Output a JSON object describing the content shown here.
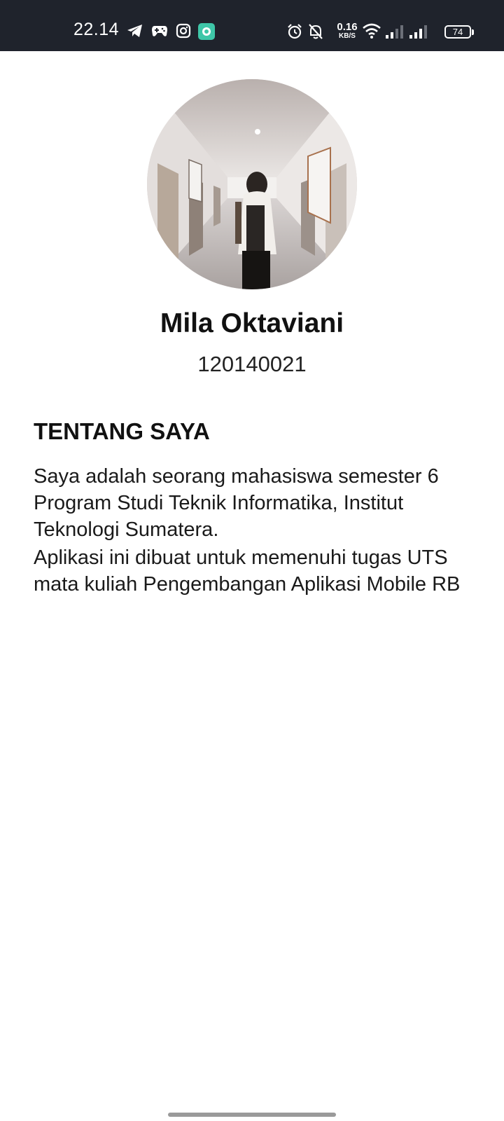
{
  "status_bar": {
    "time": "22.14",
    "speed_value": "0.16",
    "speed_unit": "KB/S",
    "battery": "74",
    "icons": [
      "telegram-icon",
      "gamepad-icon",
      "instagram-icon",
      "chat-app-icon",
      "alarm-icon",
      "bell-off-icon",
      "wifi-icon",
      "signal-icon",
      "signal-icon",
      "battery-icon"
    ]
  },
  "profile": {
    "name": "Mila Oktaviani",
    "nim": "120140021"
  },
  "about": {
    "title": "TENTANG SAYA",
    "paragraph_1": "Saya adalah seorang mahasiswa semester 6 Program Studi Teknik Informatika, Institut Teknologi Sumatera.",
    "paragraph_2": "Aplikasi ini dibuat untuk memenuhi tugas UTS mata kuliah Pengembangan Aplikasi Mobile RB"
  },
  "colors": {
    "status_bar_bg": "#1f232c",
    "page_bg": "#ffffff",
    "text": "#111111",
    "home_indicator": "#9a9a9a",
    "chat_app_accent": "#3ec6a8"
  }
}
